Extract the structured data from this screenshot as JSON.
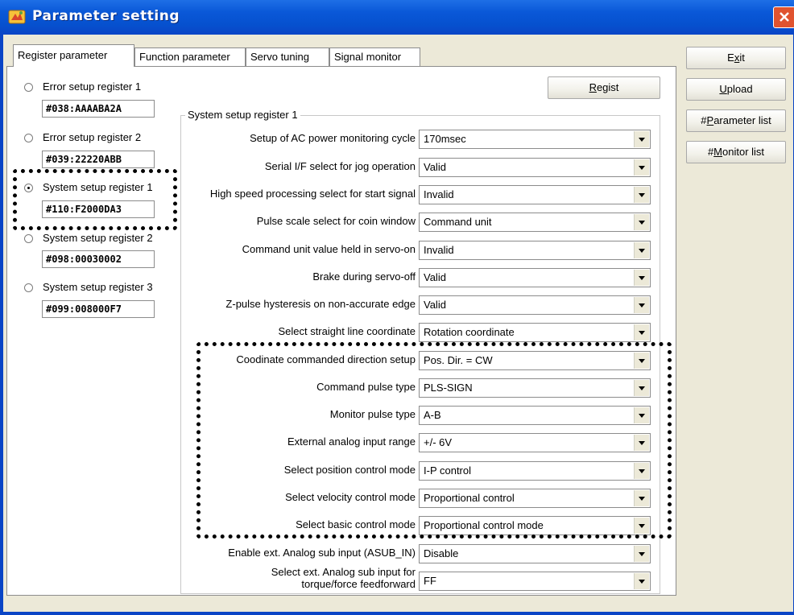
{
  "window": {
    "title": "Parameter setting"
  },
  "tabs": [
    {
      "label": "Register parameter",
      "active": true
    },
    {
      "label": "Function parameter",
      "active": false
    },
    {
      "label": "Servo tuning",
      "active": false
    },
    {
      "label": "Signal monitor",
      "active": false
    }
  ],
  "registers": [
    {
      "label": "Error setup register 1",
      "value": "#038:AAAABA2A",
      "selected": false
    },
    {
      "label": "Error setup register 2",
      "value": "#039:22220ABB",
      "selected": false
    },
    {
      "label": "System setup register 1",
      "value": "#110:F2000DA3",
      "selected": true
    },
    {
      "label": "System setup register 2",
      "value": "#098:00030002",
      "selected": false
    },
    {
      "label": "System setup register 3",
      "value": "#099:008000F7",
      "selected": false
    }
  ],
  "regist_button": {
    "label_u": "R",
    "label_rest": "egist"
  },
  "group": {
    "title": "System setup register 1"
  },
  "params": [
    {
      "label": "Setup of AC power monitoring cycle",
      "value": "170msec"
    },
    {
      "label": "Serial I/F select for jog operation",
      "value": "Valid"
    },
    {
      "label": "High speed processing select for start signal",
      "value": "Invalid"
    },
    {
      "label": "Pulse scale select for coin window",
      "value": "Command unit"
    },
    {
      "label": "Command unit value held in servo-on",
      "value": "Invalid"
    },
    {
      "label": "Brake during servo-off",
      "value": "Valid"
    },
    {
      "label": "Z-pulse hysteresis on non-accurate edge",
      "value": "Valid"
    },
    {
      "label": "Select straight line coordinate",
      "value": "Rotation coordinate"
    },
    {
      "label": "Coodinate commanded direction setup",
      "value": "Pos. Dir. = CW"
    },
    {
      "label": "Command pulse type",
      "value": "PLS-SIGN"
    },
    {
      "label": "Monitor pulse type",
      "value": "A-B"
    },
    {
      "label": "External analog input range",
      "value": "+/- 6V"
    },
    {
      "label": "Select position control mode",
      "value": "I-P control"
    },
    {
      "label": "Select velocity control mode",
      "value": "Proportional control"
    },
    {
      "label": "Select basic control mode",
      "value": "Proportional control mode"
    },
    {
      "label": "Enable ext. Analog sub input  (ASUB_IN)",
      "value": "Disable"
    },
    {
      "label_line1": "Select ext. Analog sub input for",
      "label_line2": "torque/force feedforward",
      "value": "FF"
    }
  ],
  "side_buttons": {
    "exit": {
      "pre": "E",
      "u": "x",
      "post": "it"
    },
    "upload": {
      "pre": "",
      "u": "U",
      "post": "pload"
    },
    "parameter_list": {
      "pre": "#",
      "u": "P",
      "post": "arameter list"
    },
    "monitor_list": {
      "pre": "#",
      "u": "M",
      "post": "onitor list"
    }
  }
}
